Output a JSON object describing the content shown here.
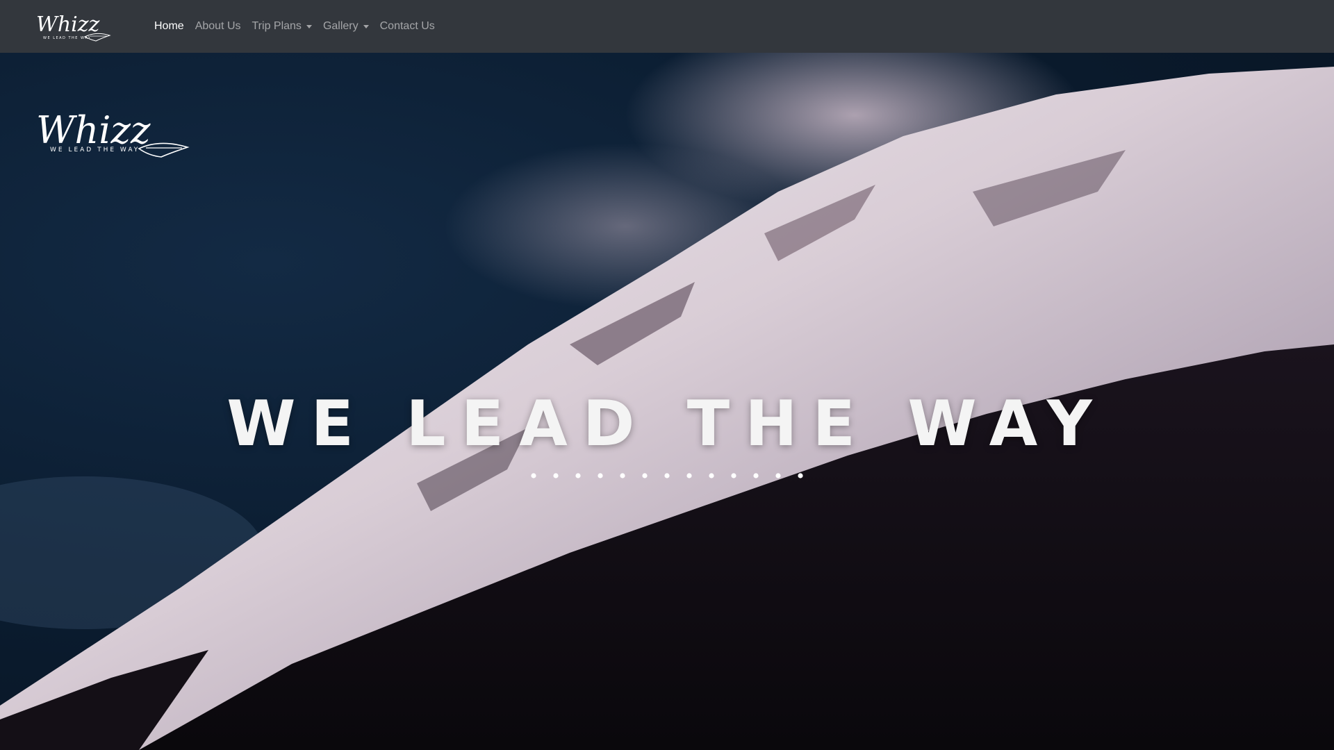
{
  "brand": {
    "name": "Whizz",
    "tagline": "WE LEAD THE WAY"
  },
  "nav": {
    "items": [
      {
        "label": "Home",
        "active": true,
        "dropdown": false
      },
      {
        "label": "About Us",
        "active": false,
        "dropdown": false
      },
      {
        "label": "Trip Plans",
        "active": false,
        "dropdown": true
      },
      {
        "label": "Gallery",
        "active": false,
        "dropdown": true
      },
      {
        "label": "Contact Us",
        "active": false,
        "dropdown": false
      }
    ]
  },
  "hero": {
    "headline": "WE LEAD THE WAY"
  },
  "colors": {
    "navbar_bg": "#33373d",
    "nav_active": "#ffffff",
    "nav_inactive": "rgba(255,255,255,0.55)",
    "sky": "#0b1d31",
    "snow": "#e9e4ea",
    "forest": "#0d0a10"
  }
}
